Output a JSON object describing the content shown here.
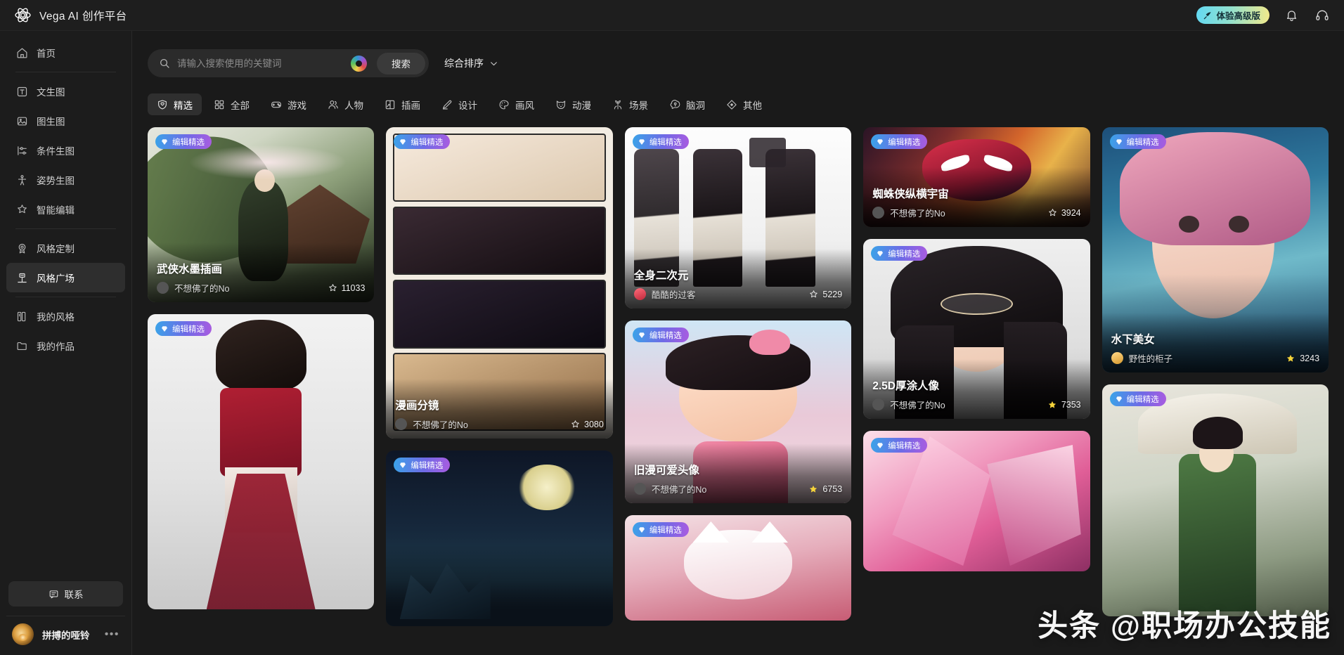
{
  "topbar": {
    "brand_title": "Vega AI 创作平台",
    "premium_label": "体验高级版",
    "notification_icon": "bell-icon",
    "support_icon": "headset-icon"
  },
  "sidebar": {
    "items": [
      {
        "label": "首页",
        "icon": "home-icon",
        "active": false
      },
      {
        "label": "文生图",
        "icon": "text-to-image-icon",
        "active": false
      },
      {
        "label": "图生图",
        "icon": "image-to-image-icon",
        "active": false
      },
      {
        "label": "条件生图",
        "icon": "sliders-icon",
        "active": false
      },
      {
        "label": "姿势生图",
        "icon": "pose-icon",
        "active": false
      },
      {
        "label": "智能编辑",
        "icon": "magic-wand-icon",
        "active": false
      },
      {
        "label": "风格定制",
        "icon": "style-custom-icon",
        "active": false
      },
      {
        "label": "风格广场",
        "icon": "style-square-icon",
        "active": true
      },
      {
        "label": "我的风格",
        "icon": "my-style-icon",
        "active": false
      },
      {
        "label": "我的作品",
        "icon": "folder-icon",
        "active": false
      }
    ],
    "contact_label": "联系",
    "profile_name": "拼搏的哑铃",
    "profile_more": "•••"
  },
  "search": {
    "placeholder": "请输入搜索使用的关键词",
    "value": "",
    "search_button": "搜索",
    "camera_icon": "camera-search-icon",
    "sort_label": "综合排序"
  },
  "tabs": [
    {
      "label": "精选",
      "icon": "heart-shield-icon",
      "active": true
    },
    {
      "label": "全部",
      "icon": "grid-icon",
      "active": false
    },
    {
      "label": "游戏",
      "icon": "gamepad-icon",
      "active": false
    },
    {
      "label": "人物",
      "icon": "people-icon",
      "active": false
    },
    {
      "label": "插画",
      "icon": "illustration-icon",
      "active": false
    },
    {
      "label": "设计",
      "icon": "design-icon",
      "active": false
    },
    {
      "label": "画风",
      "icon": "palette-icon",
      "active": false
    },
    {
      "label": "动漫",
      "icon": "cat-face-icon",
      "active": false
    },
    {
      "label": "场景",
      "icon": "scene-icon",
      "active": false
    },
    {
      "label": "脑洞",
      "icon": "brain-icon",
      "active": false
    },
    {
      "label": "其他",
      "icon": "diamond-icon",
      "active": false
    }
  ],
  "badge_label": "编辑精选",
  "cards": {
    "wuxia": {
      "title": "武侠水墨插画",
      "author": "不想佛了的No",
      "stars": "11033",
      "badge": "编辑精选",
      "star_type": "outline"
    },
    "runway": {
      "title": "",
      "author": "",
      "stars": "",
      "badge": "编辑精选",
      "star_type": "none"
    },
    "comic": {
      "title": "漫画分镜",
      "author": "不想佛了的No",
      "stars": "3080",
      "badge": "编辑精选",
      "star_type": "outline"
    },
    "moon": {
      "title": "",
      "author": "",
      "stars": "",
      "badge": "编辑精选",
      "star_type": "none"
    },
    "fullbody": {
      "title": "全身二次元",
      "author": "酷酷的过客",
      "stars": "5229",
      "badge": "编辑精选",
      "star_type": "outline"
    },
    "cute": {
      "title": "旧漫可爱头像",
      "author": "不想佛了的No",
      "stars": "6753",
      "badge": "编辑精选",
      "star_type": "filled"
    },
    "foxred": {
      "title": "",
      "author": "",
      "stars": "",
      "badge": "编辑精选",
      "star_type": "none"
    },
    "spider": {
      "title": "蜘蛛侠纵横宇宙",
      "author": "不想佛了的No",
      "stars": "3924",
      "badge": "编辑精选",
      "star_type": "outline"
    },
    "d25": {
      "title": "2.5D厚涂人像",
      "author": "不想佛了的No",
      "stars": "7353",
      "badge": "编辑精选",
      "star_type": "filled"
    },
    "crystal": {
      "title": "",
      "author": "",
      "stars": "",
      "badge": "编辑精选",
      "star_type": "none"
    },
    "underwater": {
      "title": "水下美女",
      "author": "野性的柜子",
      "stars": "3243",
      "badge": "编辑精选",
      "star_type": "filled"
    },
    "umbrella": {
      "title": "",
      "author": "",
      "stars": "",
      "badge": "编辑精选",
      "star_type": "none"
    }
  },
  "watermark": "头条 @职场办公技能",
  "colors": {
    "background": "#1a1a1a",
    "sidebar": "#1c1c1c",
    "topbar": "#1e1e1e",
    "active_item": "#2e2e2e",
    "badge_gradient_start": "#3aa3e8",
    "badge_gradient_end": "#a95ce0",
    "premium_gradient_start": "#63d9f2",
    "premium_gradient_end": "#f2e98a",
    "star_filled": "#f5d33a"
  }
}
